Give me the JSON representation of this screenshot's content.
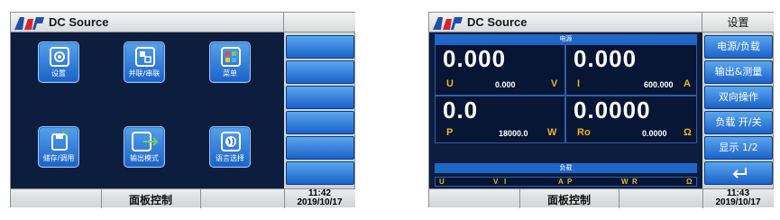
{
  "left_screen": {
    "title": "DC Source",
    "tiles": [
      {
        "label": "设置",
        "icon": "gear-icon"
      },
      {
        "label": "并联/串联",
        "icon": "parallel-series-icon"
      },
      {
        "label": "菜单",
        "icon": "menu-grid-icon"
      },
      {
        "label": "储存/调用",
        "icon": "save-recall-icon"
      },
      {
        "label": "输出模式",
        "icon": "output-mode-icon"
      },
      {
        "label": "语言选择",
        "icon": "globe-icon"
      }
    ],
    "footer": {
      "label": "面板控制",
      "time": "11:42",
      "date": "2019/10/17"
    }
  },
  "right_screen": {
    "title": "DC Source",
    "side_title": "设置",
    "section_source": "电源",
    "section_load": "负载",
    "voltage": {
      "big": "0.000",
      "label": "U",
      "setting": "0.000",
      "unit": "V"
    },
    "current": {
      "big": "0.000",
      "label": "I",
      "setting": "600.000",
      "unit": "A"
    },
    "power": {
      "big": "0.0",
      "label": "P",
      "setting": "18000.0",
      "unit": "W"
    },
    "resistance": {
      "big": "0.0000",
      "label": "Ro",
      "setting": "0.0000",
      "unit": "Ω"
    },
    "load_row": [
      {
        "label": "U",
        "unit": "V"
      },
      {
        "label": "I",
        "unit": "A"
      },
      {
        "label": "P",
        "unit": "W"
      },
      {
        "label": "R",
        "unit": "Ω"
      }
    ],
    "side_buttons": [
      "电源/负载",
      "输出&测量",
      "双向操作",
      "负载 开/关",
      "显示 1/2"
    ],
    "enter_icon": "enter-return-icon",
    "footer": {
      "label": "面板控制",
      "time": "11:43",
      "date": "2019/10/17"
    }
  },
  "colors": {
    "screen_bg": "#0c1d3e",
    "tile_blue": "#1c62c8",
    "value_white": "#ffffff",
    "label_amber": "#f0b422",
    "brand_red": "#d8242b",
    "brand_blue": "#1f4fa8"
  }
}
